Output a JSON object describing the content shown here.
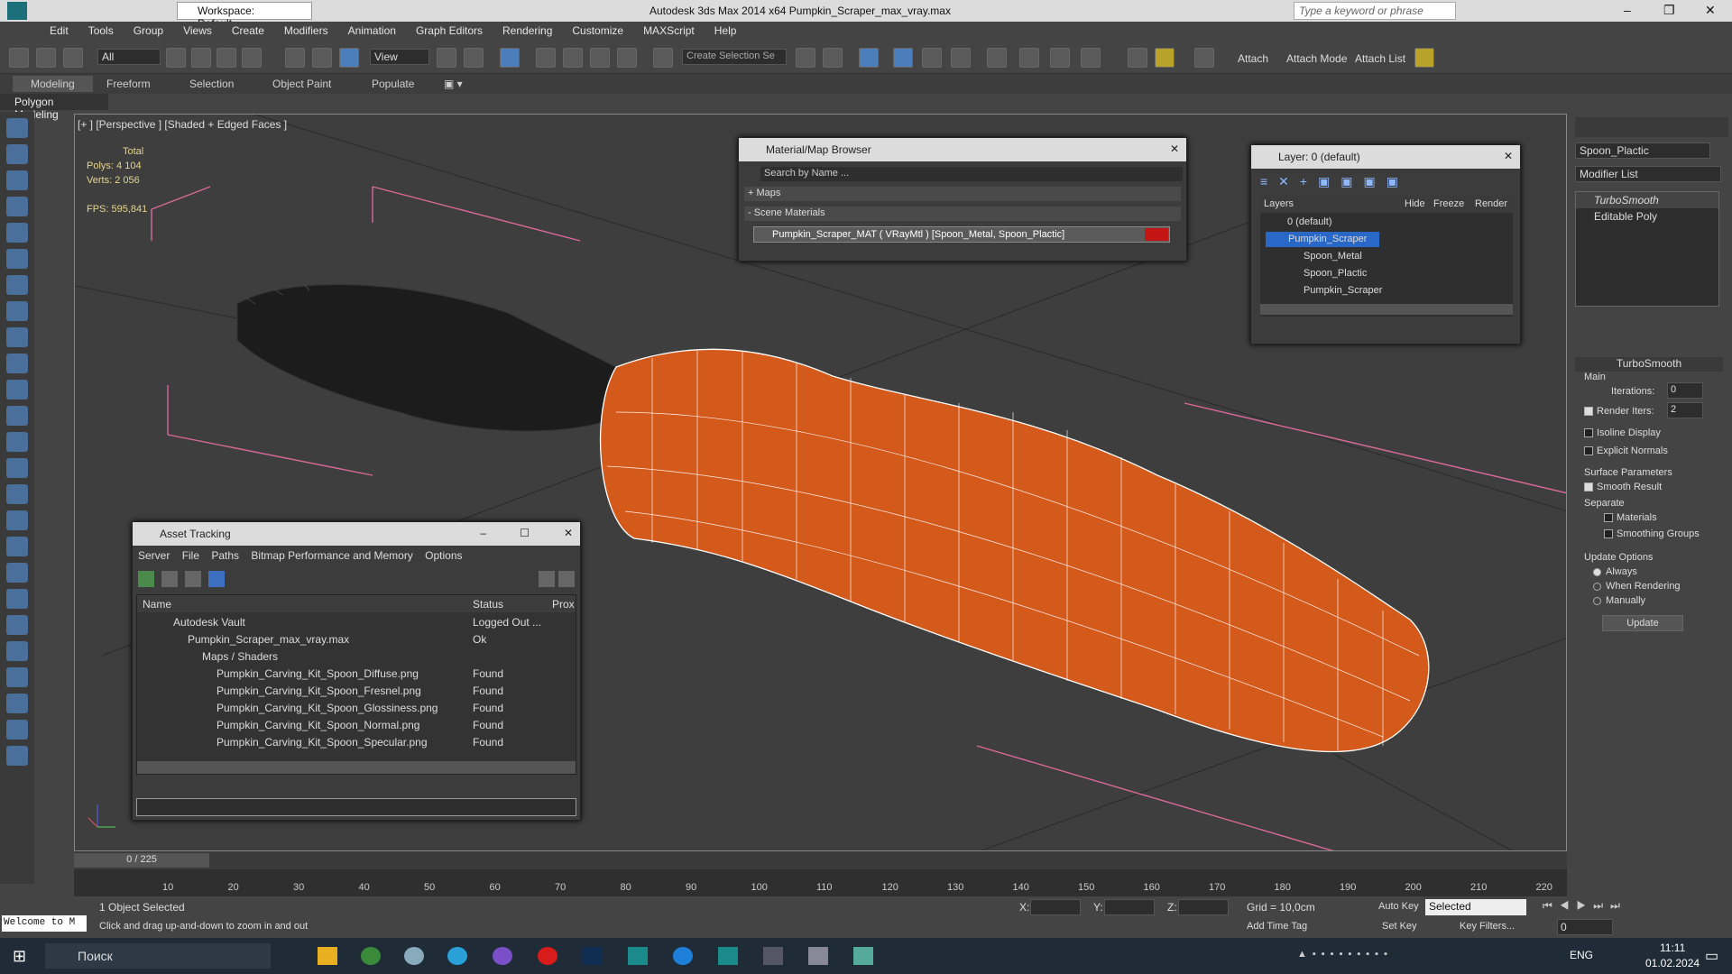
{
  "app": {
    "title": "Autodesk 3ds Max  2014 x64    Pumpkin_Scraper_max_vray.max",
    "workspace": "Workspace: Default",
    "search_placeholder": "Type a keyword or phrase"
  },
  "menu": [
    "Edit",
    "Tools",
    "Group",
    "Views",
    "Create",
    "Modifiers",
    "Animation",
    "Graph Editors",
    "Rendering",
    "Customize",
    "MAXScript",
    "Help"
  ],
  "toolbar": {
    "filter": "All",
    "view": "View",
    "selection_set": "Create Selection Se",
    "attach": "Attach",
    "attach_mode": "Attach Mode",
    "attach_list": "Attach List"
  },
  "ribbon": {
    "tabs": [
      "Modeling",
      "Freeform",
      "Selection",
      "Object Paint",
      "Populate"
    ],
    "sub": "Polygon Modeling"
  },
  "viewport": {
    "label": "[+ ] [Perspective ] [Shaded + Edged Faces ]",
    "total": "Total",
    "polys_label": "Polys:",
    "polys": "4 104",
    "verts_label": "Verts:",
    "verts": "2 056",
    "fps_label": "FPS:",
    "fps": "595,841"
  },
  "material_browser": {
    "title": "Material/Map Browser",
    "search": "Search by Name ...",
    "maps": "+ Maps",
    "scene": "- Scene Materials",
    "material": "Pumpkin_Scraper_MAT  ( VRayMtl ) [Spoon_Metal, Spoon_Plactic]"
  },
  "layer": {
    "title": "Layer: 0 (default)",
    "cols": [
      "Layers",
      "Hide",
      "Freeze",
      "Render"
    ],
    "rows": [
      "0 (default)",
      "Pumpkin_Scraper",
      "Spoon_Metal",
      "Spoon_Plactic",
      "Pumpkin_Scraper"
    ]
  },
  "asset": {
    "title": "Asset Tracking",
    "menu": [
      "Server",
      "File",
      "Paths",
      "Bitmap Performance and Memory",
      "Options"
    ],
    "cols": [
      "Name",
      "Status",
      "Prox"
    ],
    "rows": [
      {
        "name": "Autodesk Vault",
        "status": "Logged Out ..."
      },
      {
        "name": "Pumpkin_Scraper_max_vray.max",
        "status": "Ok"
      },
      {
        "name": "Maps / Shaders",
        "status": ""
      },
      {
        "name": "Pumpkin_Carving_Kit_Spoon_Diffuse.png",
        "status": "Found"
      },
      {
        "name": "Pumpkin_Carving_Kit_Spoon_Fresnel.png",
        "status": "Found"
      },
      {
        "name": "Pumpkin_Carving_Kit_Spoon_Glossiness.png",
        "status": "Found"
      },
      {
        "name": "Pumpkin_Carving_Kit_Spoon_Normal.png",
        "status": "Found"
      },
      {
        "name": "Pumpkin_Carving_Kit_Spoon_Specular.png",
        "status": "Found"
      }
    ]
  },
  "cmd": {
    "object_name": "Spoon_Plactic",
    "modifier_list": "Modifier List",
    "stack": [
      "TurboSmooth",
      "Editable Poly"
    ],
    "rollout": "TurboSmooth",
    "main": "Main",
    "iterations_label": "Iterations:",
    "iterations": "0",
    "render_iters_label": "Render Iters:",
    "render_iters": "2",
    "isoline": "Isoline Display",
    "explicit": "Explicit Normals",
    "surface": "Surface Parameters",
    "smooth_result": "Smooth Result",
    "separate": "Separate",
    "materials": "Materials",
    "smoothing": "Smoothing Groups",
    "update_options": "Update Options",
    "always": "Always",
    "when_rendering": "When Rendering",
    "manually": "Manually",
    "update": "Update"
  },
  "timeline": {
    "frame": "0 / 225",
    "ticks": [
      "10",
      "20",
      "30",
      "40",
      "50",
      "60",
      "70",
      "80",
      "90",
      "100",
      "110",
      "120",
      "130",
      "140",
      "150",
      "160",
      "170",
      "180",
      "190",
      "200",
      "210",
      "220"
    ]
  },
  "status": {
    "welcome": "Welcome to M",
    "selected": "1 Object Selected",
    "hint": "Click and drag up-and-down to zoom in and out",
    "x": "X:",
    "y": "Y:",
    "z": "Z:",
    "grid": "Grid = 10,0cm",
    "add_time_tag": "Add Time Tag",
    "auto_key": "Auto Key",
    "set_key": "Set Key",
    "key_mode": "Selected",
    "key_filters": "Key Filters...",
    "frame_field": "0"
  },
  "taskbar": {
    "search": "Поиск",
    "time": "11:11",
    "date": "01.02.2024",
    "lang": "ENG"
  }
}
